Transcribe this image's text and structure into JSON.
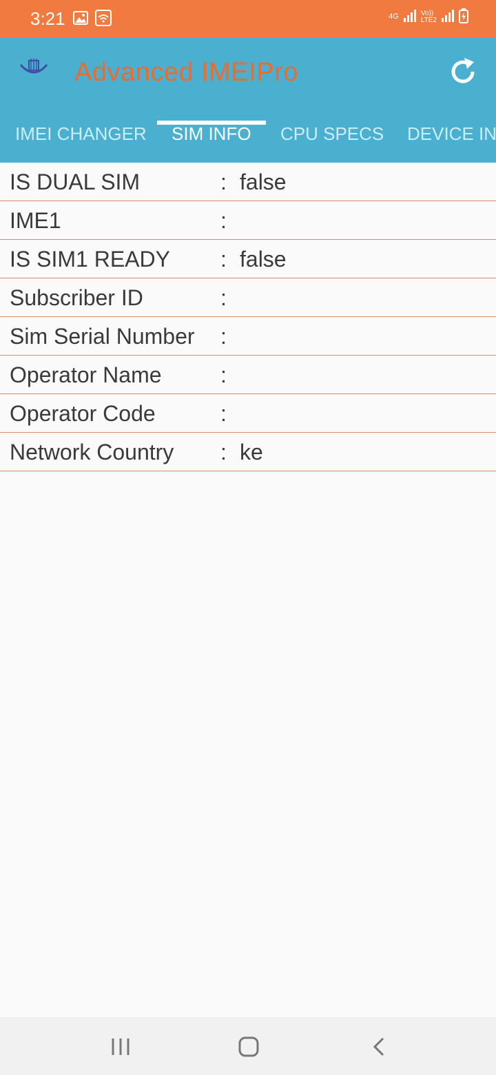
{
  "status_bar": {
    "time": "3:21",
    "network_label": "4G",
    "volte_label": "Vo))",
    "lte_label": "LTE2"
  },
  "app_bar": {
    "title": "Advanced IMEIPro",
    "refresh_icon": "refresh-icon",
    "logo_icon": "app-logo-icon"
  },
  "tabs": [
    {
      "label": "IMEI CHANGER"
    },
    {
      "label": "SIM INFO"
    },
    {
      "label": "CPU SPECS"
    },
    {
      "label": "DEVICE INFO"
    }
  ],
  "active_tab": "SIM INFO",
  "sim_info": {
    "rows": [
      {
        "label": "IS DUAL SIM",
        "value": "false"
      },
      {
        "label": "IME1",
        "value": ""
      },
      {
        "label": "IS SIM1 READY",
        "value": "false"
      },
      {
        "label": "Subscriber ID",
        "value": ""
      },
      {
        "label": "Sim Serial Number",
        "value": ""
      },
      {
        "label": "Operator Name",
        "value": ""
      },
      {
        "label": "Operator Code",
        "value": ""
      },
      {
        "label": "Network Country",
        "value": "ke"
      }
    ],
    "separator": ":"
  },
  "nav_bar": {
    "recent_icon": "recent-apps-icon",
    "home_icon": "home-icon",
    "back_icon": "back-icon"
  },
  "colors": {
    "status_bar": "#f07a3f",
    "app_bar": "#4bb0d0",
    "title": "#f06a2a",
    "divider": "#d98a5f"
  }
}
